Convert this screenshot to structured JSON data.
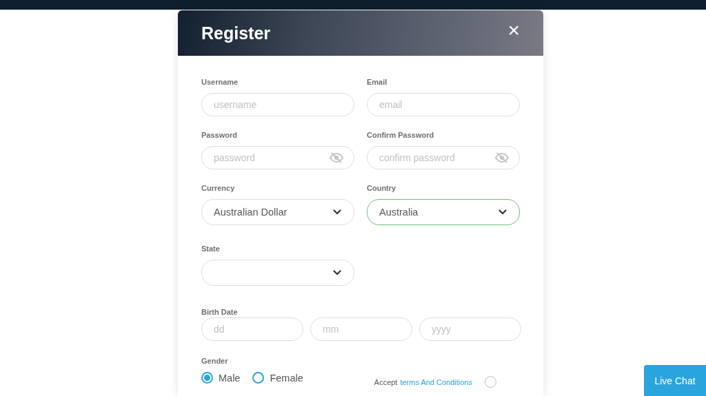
{
  "dialog": {
    "title": "Register",
    "close": "×"
  },
  "rows": [
    {
      "fields": [
        {
          "kind": "text",
          "label": "Username",
          "placeholder": "username"
        },
        {
          "kind": "text",
          "label": "Email",
          "placeholder": "email"
        }
      ]
    },
    {
      "fields": [
        {
          "kind": "password",
          "label": "Password",
          "placeholder": "password"
        },
        {
          "kind": "password",
          "label": "Confirm Password",
          "placeholder": "confirm password"
        }
      ]
    },
    {
      "fields": [
        {
          "kind": "select",
          "label": "Currency",
          "value": "Australian Dollar",
          "focused": false
        },
        {
          "kind": "select",
          "label": "Country",
          "value": "Australia",
          "focused": true
        }
      ]
    },
    {
      "fields": [
        {
          "kind": "select",
          "label": "State",
          "focused": false
        }
      ]
    }
  ],
  "birth_date": {
    "label": "Birth Date",
    "parts": [
      {
        "placeholder": "dd"
      },
      {
        "placeholder": "mm"
      },
      {
        "placeholder": "yyyy"
      }
    ]
  },
  "gender": {
    "label": "Gender",
    "options": [
      {
        "label": "Male",
        "selected": true
      },
      {
        "label": "Female",
        "selected": false
      }
    ]
  },
  "terms": {
    "prefix": "Accept",
    "link": "terms And Conditions",
    "checked": false
  },
  "live_chat": "Live Chat"
}
